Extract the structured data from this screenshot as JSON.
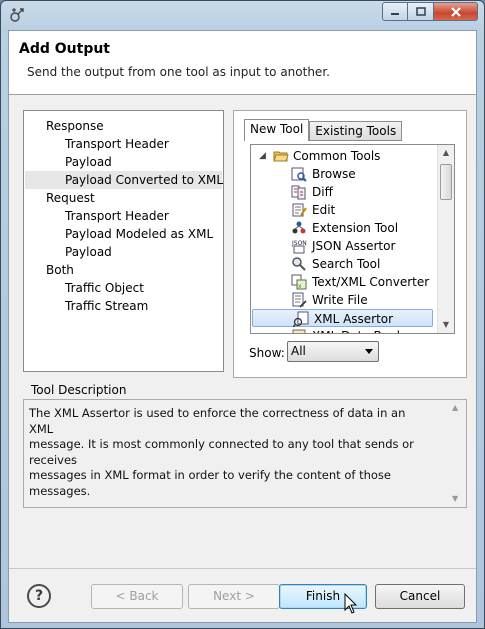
{
  "dialog": {
    "title": "Add Output",
    "description": "Send the output from one tool as input to another."
  },
  "left_tree": [
    {
      "label": "Response",
      "level": 0,
      "selected": false
    },
    {
      "label": "Transport Header",
      "level": 1,
      "selected": false
    },
    {
      "label": "Payload",
      "level": 1,
      "selected": false
    },
    {
      "label": "Payload Converted to XML",
      "level": 1,
      "selected": true
    },
    {
      "label": "Request",
      "level": 0,
      "selected": false
    },
    {
      "label": "Transport Header",
      "level": 1,
      "selected": false
    },
    {
      "label": "Payload Modeled as XML",
      "level": 1,
      "selected": false
    },
    {
      "label": "Payload",
      "level": 1,
      "selected": false
    },
    {
      "label": "Both",
      "level": 0,
      "selected": false
    },
    {
      "label": "Traffic Object",
      "level": 1,
      "selected": false
    },
    {
      "label": "Traffic Stream",
      "level": 1,
      "selected": false
    }
  ],
  "tabs": {
    "new_tool": "New Tool",
    "existing_tools": "Existing Tools"
  },
  "tool_tree": {
    "group": {
      "label": "Common Tools",
      "icon": "folder-open-icon"
    },
    "items": [
      {
        "label": "Browse",
        "icon": "browse-icon",
        "selected": false
      },
      {
        "label": "Diff",
        "icon": "diff-icon",
        "selected": false
      },
      {
        "label": "Edit",
        "icon": "edit-icon",
        "selected": false
      },
      {
        "label": "Extension Tool",
        "icon": "extension-tool-icon",
        "selected": false
      },
      {
        "label": "JSON Assertor",
        "icon": "json-assertor-icon",
        "selected": false
      },
      {
        "label": "Search Tool",
        "icon": "search-icon",
        "selected": false
      },
      {
        "label": "Text/XML Converter",
        "icon": "converter-icon",
        "selected": false
      },
      {
        "label": "Write File",
        "icon": "write-file-icon",
        "selected": false
      },
      {
        "label": "XML Assertor",
        "icon": "xml-assertor-icon",
        "selected": true
      },
      {
        "label": "XML Data Bank",
        "icon": "xml-data-bank-icon",
        "selected": false
      }
    ]
  },
  "show": {
    "label": "Show:",
    "value": "All"
  },
  "tool_description": {
    "label": "Tool Description",
    "lines": [
      "The XML Assertor is used to enforce the correctness of data in an XML",
      "message. It is most commonly connected to any tool that sends or receives",
      "messages in XML format in order to verify the content of those messages."
    ]
  },
  "buttons": {
    "help": "?",
    "back": "< Back",
    "next": "Next >",
    "finish": "Finish",
    "cancel": "Cancel"
  },
  "colors": {
    "selection_fill": "#cfe2f7",
    "selection_border": "#84acdd",
    "default_button": "#bee6fd"
  }
}
